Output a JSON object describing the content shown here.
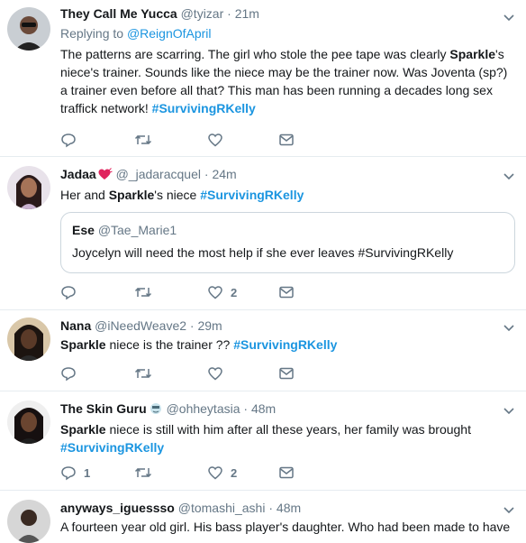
{
  "tweets": [
    {
      "name": "They Call Me Yucca",
      "handle": "@tyizar",
      "dot": "·",
      "time": "21m",
      "replying_prefix": "Replying to ",
      "replying_to": "@ReignOfApril",
      "text_pre": "The patterns are scarring. The girl who stole the pee tape was clearly ",
      "bold": "Sparkle",
      "text_post": "'s niece's trainer. Sounds like the niece may be the trainer now. Was Joventa (sp?) a trainer even before all that? This man has been running a decades long sex traffick network! ",
      "hashtag": "#SurvivingRKelly",
      "reply_count": "",
      "like_count": ""
    },
    {
      "name": "Jadaa",
      "name_emoji": "heart-icon",
      "handle": "@_jadaracquel",
      "dot": "·",
      "time": "24m",
      "text_pre": "Her and ",
      "bold": "Sparkle",
      "text_post": "'s niece ",
      "hashtag": "#SurvivingRKelly",
      "quote": {
        "name": "Ese",
        "handle": "@Tae_Marie1",
        "text": "Joycelyn will need the most help if she ever leaves #SurvivingRKelly"
      },
      "reply_count": "",
      "like_count": "2"
    },
    {
      "name": "Nana",
      "handle": "@iNeedWeave2",
      "dot": "·",
      "time": "29m",
      "text_pre": "",
      "bold": "Sparkle",
      "text_post": " niece is the trainer ?? ",
      "hashtag": "#SurvivingRKelly",
      "reply_count": "",
      "like_count": ""
    },
    {
      "name": "The Skin Guru",
      "name_emoji": "face-icon",
      "handle": "@ohheytasia",
      "dot": "·",
      "time": "48m",
      "text_pre": "",
      "bold": "Sparkle",
      "text_post": " niece is still with him after all these years, her family was brought ",
      "hashtag": "#SurvivingRKelly",
      "reply_count": "1",
      "like_count": "2"
    },
    {
      "name": "anyways_iguessso",
      "handle": "@tomashi_ashi",
      "dot": "·",
      "time": "48m",
      "text_pre": "A fourteen year old girl. His bass player's daughter. Who had been made to have",
      "bold": "",
      "text_post": "",
      "hashtag": "",
      "reply_count": "",
      "like_count": ""
    }
  ],
  "colors": {
    "link": "#1b95e0",
    "muted": "#657786",
    "divider": "#e6ecf0"
  }
}
